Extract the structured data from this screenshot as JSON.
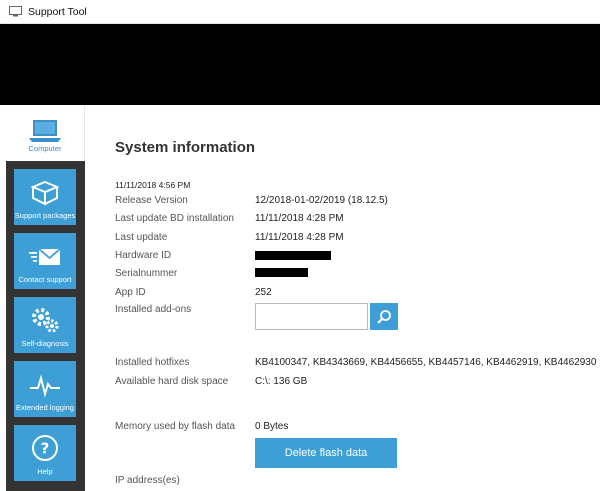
{
  "window": {
    "title": "Support Tool"
  },
  "sidebar": {
    "items": [
      {
        "label": "Computer",
        "icon": "laptop-icon",
        "active": true
      },
      {
        "label": "Support packages",
        "icon": "package-icon"
      },
      {
        "label": "Contact support",
        "icon": "envelope-icon"
      },
      {
        "label": "Self-diagnosis",
        "icon": "gears-icon"
      },
      {
        "label": "Extended logging",
        "icon": "pulse-icon"
      },
      {
        "label": "Help",
        "icon": "question-icon"
      }
    ]
  },
  "main": {
    "title": "System information",
    "timestamp": "11/11/2018 4:56 PM",
    "release_version": {
      "label": "Release Version",
      "value": "12/2018-01-02/2019 (18.12.5)"
    },
    "last_update_bd": {
      "label": "Last update BD installation",
      "value": "11/11/2018 4:28 PM"
    },
    "last_update": {
      "label": "Last update",
      "value": "11/11/2018 4:28 PM"
    },
    "hardware_id": {
      "label": "Hardware ID"
    },
    "serial_number": {
      "label": "Serialnummer"
    },
    "app_id": {
      "label": "App ID",
      "value": "252"
    },
    "installed_addons": {
      "label": "Installed add-ons",
      "placeholder": ""
    },
    "installed_hotfixes": {
      "label": "Installed hotfixes",
      "value": "KB4100347, KB4343669, KB4456655, KB4457146, KB4462919, KB4462930"
    },
    "disk_space": {
      "label": "Available hard disk space",
      "value": "C:\\: 136 GB"
    },
    "flash_memory": {
      "label": "Memory used by flash data",
      "value": "0 Bytes"
    },
    "delete_flash_label": "Delete flash data",
    "ip_addresses": {
      "label": "IP address(es)"
    }
  },
  "colors": {
    "accent": "#3d9fd6",
    "sidebar": "#333333",
    "banner": "#000000"
  }
}
